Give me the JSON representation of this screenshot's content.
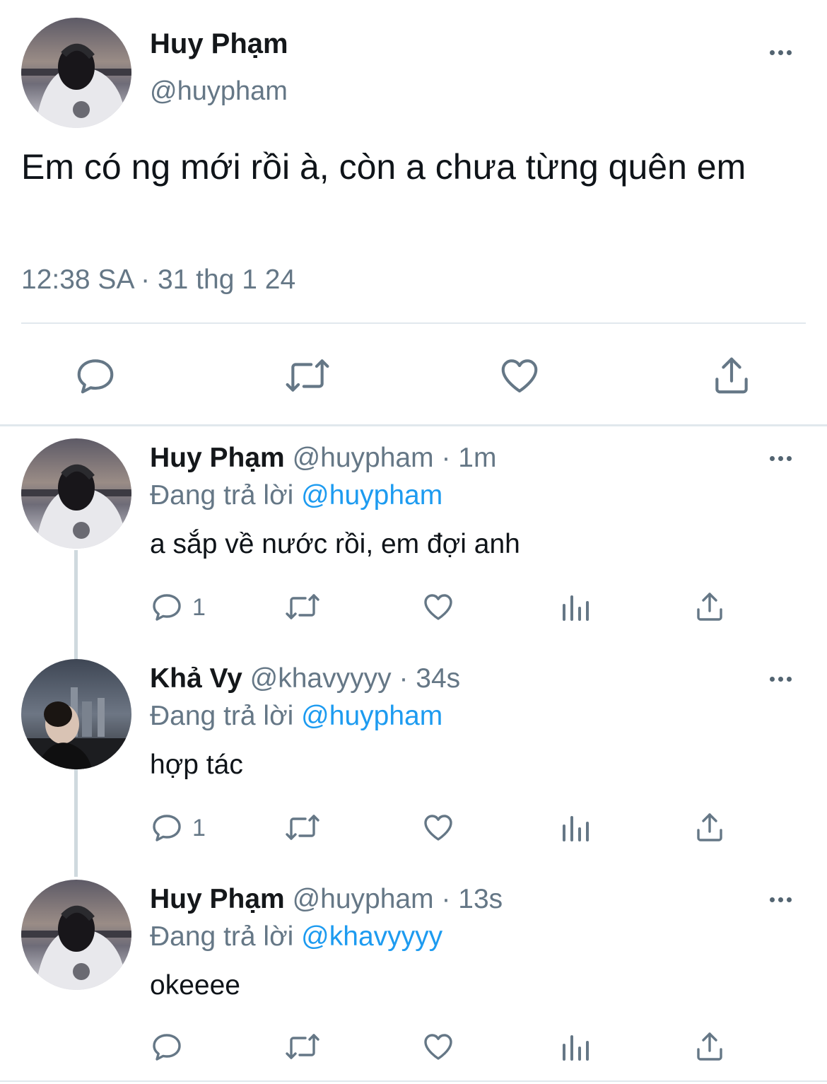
{
  "main_tweet": {
    "author_name": "Huy Phạm",
    "handle": "@huypham",
    "text": "Em có ng mới rồi à, còn a chưa từng quên em",
    "timestamp": "12:38 SA · 31 thg 1 24"
  },
  "replies": [
    {
      "author_name": "Huy Phạm",
      "handle": "@huypham",
      "time": "· 1m",
      "replying_label": "Đang trả lời",
      "replying_to": "@huypham",
      "text": "a sắp về nước rồi, em đợi anh",
      "reply_count": "1"
    },
    {
      "author_name": "Khả Vy",
      "handle": "@khavyyyy",
      "time": "· 34s",
      "replying_label": "Đang trả lời",
      "replying_to": "@huypham",
      "text": "hợp tác",
      "reply_count": "1"
    },
    {
      "author_name": "Huy Phạm",
      "handle": "@huypham",
      "time": "· 13s",
      "replying_label": "Đang trả lời",
      "replying_to": "@khavyyyy",
      "text": "okeeee",
      "reply_count": ""
    }
  ],
  "icons": [
    "more-icon",
    "reply-icon",
    "retweet-icon",
    "like-icon",
    "share-icon",
    "analytics-icon"
  ],
  "colors": {
    "text": "#14171a",
    "muted": "#657786",
    "link": "#1d9bf0",
    "divider": "#e1e8ed",
    "thread_line": "#cfd9de"
  }
}
